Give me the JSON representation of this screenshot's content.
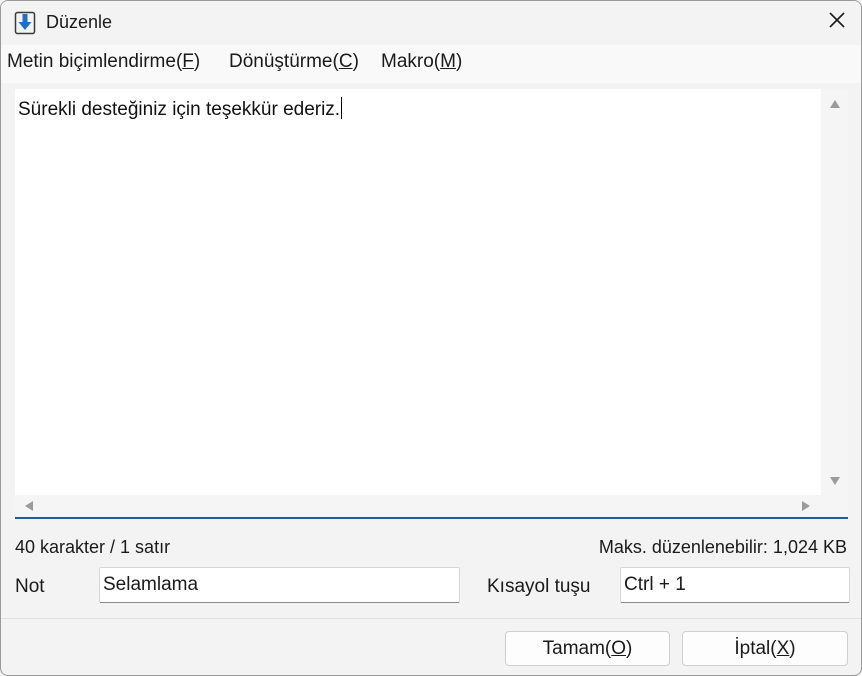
{
  "window": {
    "title": "Düzenle",
    "app_icon": "download-arrow-icon",
    "close_icon": "close-icon",
    "accent_color": "#1f5e9e"
  },
  "menu": [
    {
      "label": "Metin biçimlendirme(",
      "mnemonic": "F",
      "suffix": ")"
    },
    {
      "label": "Dönüştürme(",
      "mnemonic": "C",
      "suffix": ")"
    },
    {
      "label": "Makro(",
      "mnemonic": "M",
      "suffix": ")"
    }
  ],
  "editor": {
    "content": "Sürekli desteğiniz için teşekkür ederiz."
  },
  "status": {
    "counts": "40 karakter / 1 satır",
    "max_size": "Maks. düzenlenebilir: 1,024 KB"
  },
  "form": {
    "note_label": "Not",
    "note_value": "Selamlama",
    "shortcut_label": "Kısayol tuşu",
    "shortcut_value": "Ctrl + 1"
  },
  "buttons": {
    "ok": {
      "label": "Tamam(",
      "mnemonic": "O",
      "suffix": ")"
    },
    "cancel": {
      "label": "İptal(",
      "mnemonic": "X",
      "suffix": ")"
    }
  }
}
